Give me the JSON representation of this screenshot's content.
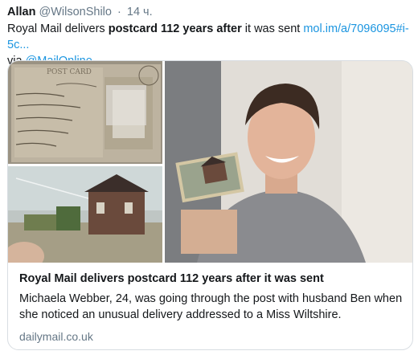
{
  "tweet": {
    "author_name": "Allan",
    "handle": "@WilsonShilo",
    "separator": "·",
    "time": "14 ч.",
    "text_part1": "Royal Mail delivers ",
    "text_bold": "postcard 112 years after",
    "text_part2": " it was sent ",
    "text_link": "mol.im/a/7096095#i-5c...",
    "text_via": "via ",
    "text_mention": "@MailOnline"
  },
  "card": {
    "title": "Royal Mail delivers postcard 112 years after it was sent",
    "description": "Michaela Webber, 24, was going through the post with husband Ben when she noticed an unusual delivery addressed to a Miss Wiltshire.",
    "domain": "dailymail.co.uk",
    "postcard_printed_text": "POST CARD"
  },
  "colors": {
    "link": "#1b95e0",
    "secondary_text": "#657786",
    "primary_text": "#14171a",
    "card_border": "#d8dde2"
  }
}
